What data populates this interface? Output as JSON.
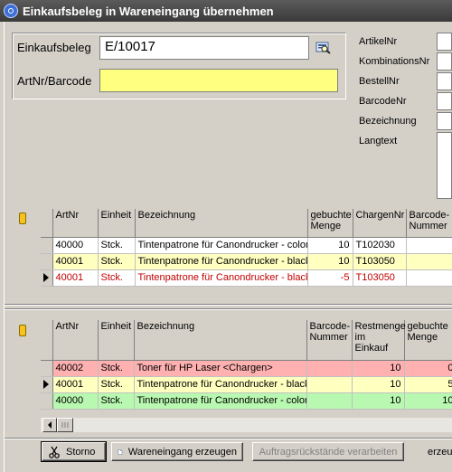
{
  "window": {
    "title": "Einkaufsbeleg in Wareneingang übernehmen"
  },
  "header": {
    "einkaufsbeleg_label": "Einkaufsbeleg",
    "einkaufsbeleg_value": "E/10017",
    "artnr_barcode_label": "ArtNr/Barcode",
    "artnr_barcode_value": ""
  },
  "details": {
    "artikelnr_label": "ArtikelNr",
    "kombinationsnr_label": "KombinationsNr",
    "bestellnr_label": "BestellNr",
    "barcodenr_label": "BarcodeNr",
    "bezeichnung_label": "Bezeichnung",
    "langtext_label": "Langtext"
  },
  "grid_top": {
    "headers": [
      "ArtNr",
      "Einheit",
      "Bezeichnung",
      "gebuchte Menge",
      "ChargenNr",
      "Barcode-Nummer"
    ],
    "rows": [
      {
        "artnr": "40000",
        "einheit": "Stck.",
        "bezeichnung": "Tintenpatrone für Canondrucker - color",
        "menge": "10",
        "chargennr": "T102030",
        "barcode": ""
      },
      {
        "artnr": "40001",
        "einheit": "Stck.",
        "bezeichnung": "Tintenpatrone für Canondrucker - black",
        "menge": "10",
        "chargennr": "T103050",
        "barcode": ""
      },
      {
        "artnr": "40001",
        "einheit": "Stck.",
        "bezeichnung": "Tintenpatrone für Canondrucker - black",
        "menge": "-5",
        "chargennr": "T103050",
        "barcode": ""
      }
    ]
  },
  "grid_bottom": {
    "headers": [
      "ArtNr",
      "Einheit",
      "Bezeichnung",
      "Barcode-Nummer",
      "Restmenge im Einkauf",
      "gebuchte Menge"
    ],
    "rows": [
      {
        "artnr": "40002",
        "einheit": "Stck.",
        "bezeichnung": "Toner für HP Laser <Chargen>",
        "barcode": "",
        "restmenge": "10",
        "menge": "0"
      },
      {
        "artnr": "40001",
        "einheit": "Stck.",
        "bezeichnung": "Tintenpatrone für Canondrucker - black",
        "barcode": "",
        "restmenge": "10",
        "menge": "5"
      },
      {
        "artnr": "40000",
        "einheit": "Stck.",
        "bezeichnung": "Tintenpatrone für Canondrucker - color",
        "barcode": "",
        "restmenge": "10",
        "menge": "10"
      }
    ]
  },
  "buttons": {
    "storno": "Storno",
    "wareneingang": "Wareneingang erzeugen",
    "auftragsrueckstaende": "Auftragsrückstände verarbeiten",
    "erzeugen_cut": "erzeug"
  },
  "colors": {
    "yellow_field": "#ffff80",
    "row_yellow": "#ffffc0",
    "row_red_text": "#c00000",
    "row_pink": "#ffb0b0",
    "row_green": "#b8f8b0"
  }
}
